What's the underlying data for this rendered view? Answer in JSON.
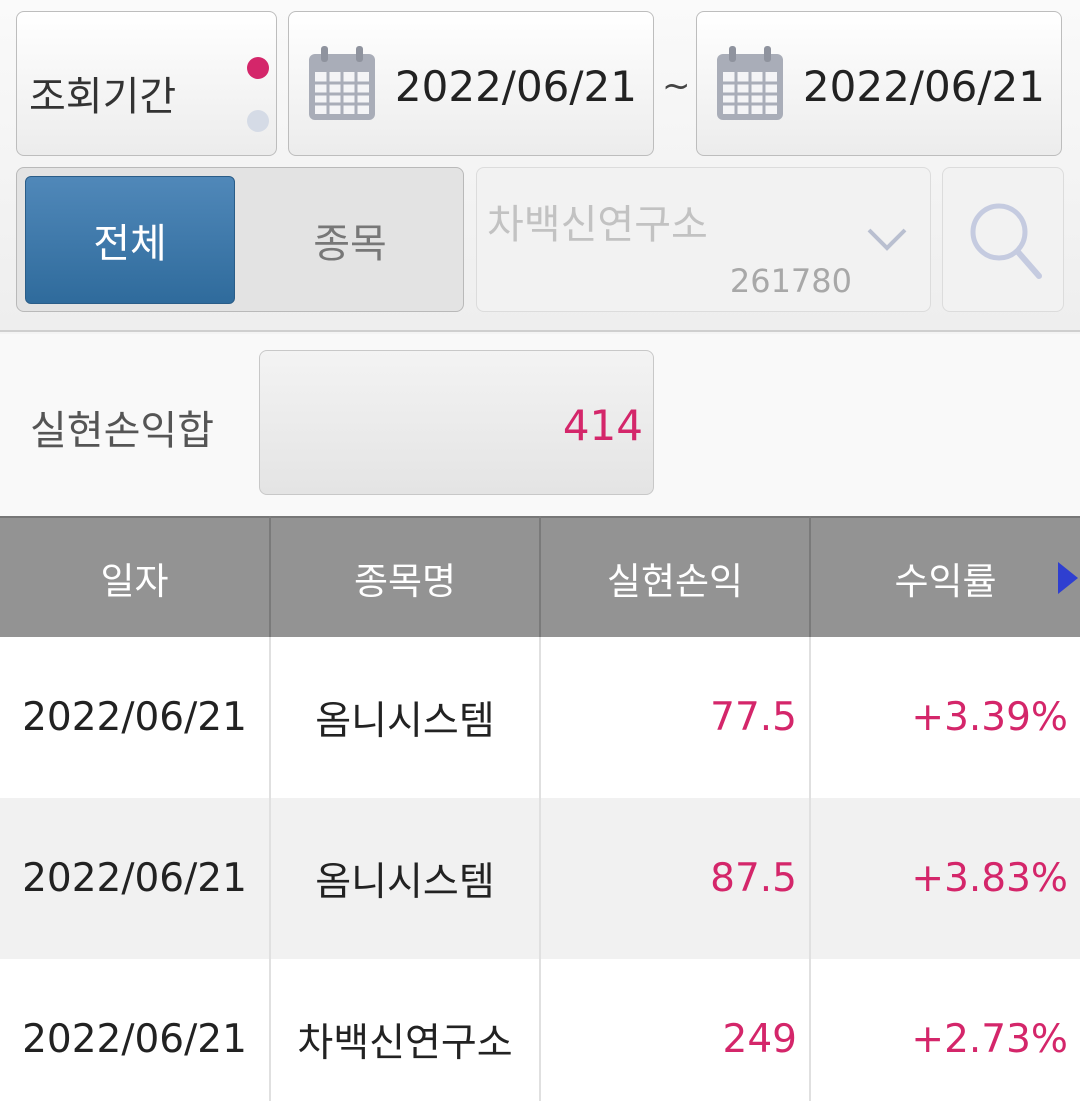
{
  "period": {
    "label": "조회기간",
    "start_date": "2022/06/21",
    "separator": "~",
    "end_date": "2022/06/21"
  },
  "filter": {
    "all_label": "전체",
    "item_label": "종목",
    "selected": "전체"
  },
  "stock": {
    "name": "차백신연구소",
    "code": "261780"
  },
  "summary": {
    "label": "실현손익합",
    "value": "414"
  },
  "table": {
    "headers": [
      "일자",
      "종목명",
      "실현손익",
      "수익률"
    ],
    "rows": [
      {
        "date": "2022/06/21",
        "name": "옴니시스템",
        "profit": "77.5",
        "rate": "+3.39%"
      },
      {
        "date": "2022/06/21",
        "name": "옴니시스템",
        "profit": "87.5",
        "rate": "+3.83%"
      },
      {
        "date": "2022/06/21",
        "name": "차백신연구소",
        "profit": "249",
        "rate": "+2.73%"
      }
    ]
  },
  "colors": {
    "accent": "#d4266a",
    "selected_button": "#3a77a8",
    "header_bg": "#939393"
  },
  "icons": [
    "calendar-icon",
    "chevron-down-icon",
    "search-icon",
    "scroll-right-icon"
  ]
}
